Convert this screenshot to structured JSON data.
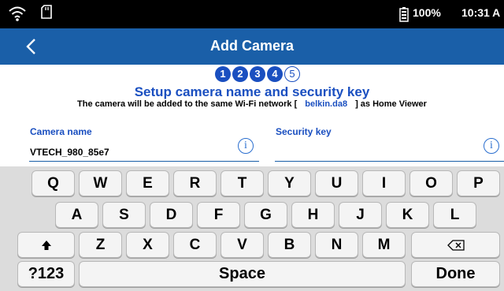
{
  "status_bar": {
    "icons": [
      "wifi-icon",
      "sd-card-icon",
      "battery-icon"
    ],
    "battery": "100%",
    "time": "10:31 A"
  },
  "header": {
    "title": "Add Camera",
    "back_icon": "chevron-left-icon"
  },
  "steps": {
    "items": [
      "1",
      "2",
      "3",
      "4",
      "5"
    ],
    "current": 5
  },
  "setup": {
    "heading": "Setup camera name and security key",
    "network_prefix": "The camera will be added to the same Wi-Fi network [",
    "network_name": "belkin.da8",
    "network_suffix": "] as Home Viewer"
  },
  "form": {
    "camera_name_label": "Camera name",
    "camera_name_value": "VTECH_980_85e7",
    "security_key_label": "Security key",
    "security_key_value": "",
    "info_icon_glyph": "i"
  },
  "keyboard": {
    "row1": [
      "Q",
      "W",
      "E",
      "R",
      "T",
      "Y",
      "U",
      "I",
      "O",
      "P"
    ],
    "row2": [
      "A",
      "S",
      "D",
      "F",
      "G",
      "H",
      "J",
      "K",
      "L"
    ],
    "row3": [
      "Z",
      "X",
      "C",
      "V",
      "B",
      "N",
      "M"
    ],
    "symbols": "?123",
    "space": "Space",
    "done": "Done",
    "shift_icon": "shift-arrow-icon",
    "backspace_icon": "backspace-icon"
  },
  "colors": {
    "header_bg": "#1a5fa8",
    "accent_blue": "#1a4fc0",
    "keyboard_bg": "#dcdcdc"
  }
}
